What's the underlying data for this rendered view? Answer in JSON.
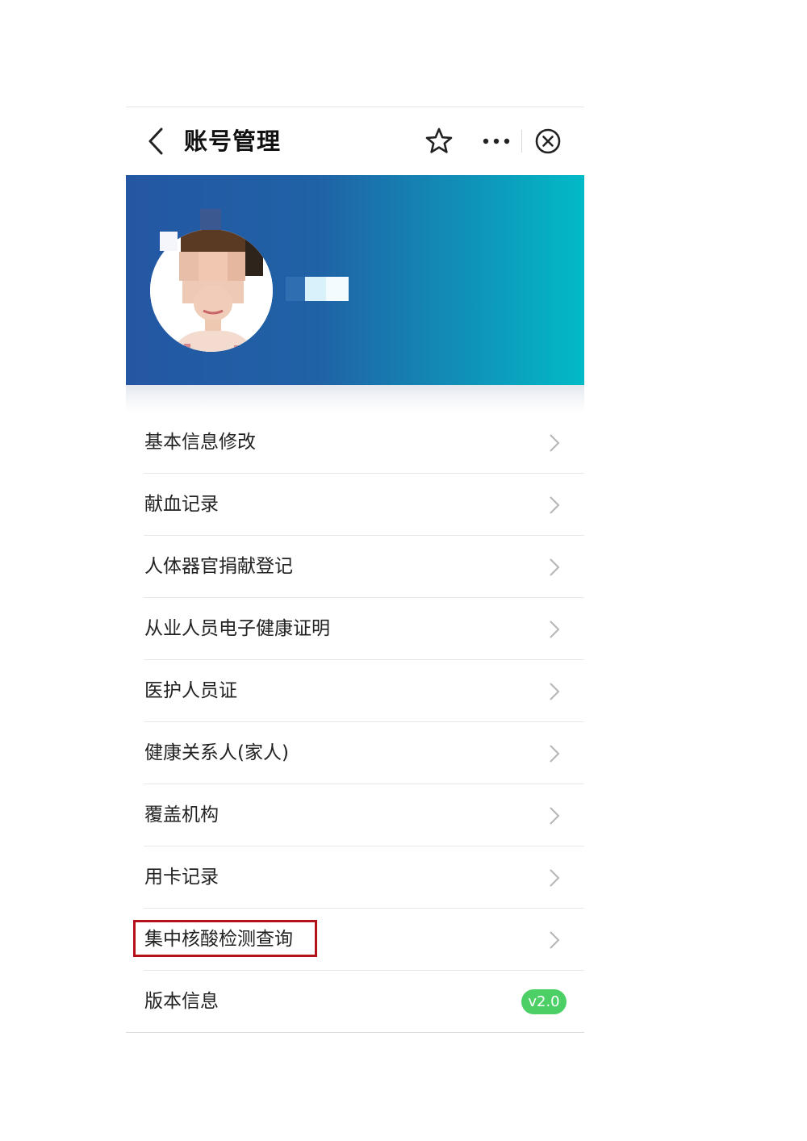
{
  "navbar": {
    "title": "账号管理",
    "back_icon": "chevron-left-icon",
    "favorite_icon": "star-outline-icon",
    "more_icon": "ellipsis-icon",
    "close_icon": "close-circle-icon"
  },
  "profile": {
    "avatar": "blurred-profile-photo",
    "name": "",
    "banner_colors": [
      "#2457a3",
      "#02bac7"
    ]
  },
  "menu": {
    "items": [
      {
        "label": "基本信息修改"
      },
      {
        "label": "献血记录"
      },
      {
        "label": "人体器官捐献登记"
      },
      {
        "label": "从业人员电子健康证明"
      },
      {
        "label": "医护人员证"
      },
      {
        "label": "健康关系人(家人)"
      },
      {
        "label": "覆盖机构"
      },
      {
        "label": "用卡记录"
      },
      {
        "label": "集中核酸检测查询",
        "highlighted": true
      },
      {
        "label": "版本信息",
        "badge": "v2.0"
      }
    ]
  },
  "colors": {
    "highlight_border": "#b3121b",
    "badge_bg": "#4cd066"
  }
}
